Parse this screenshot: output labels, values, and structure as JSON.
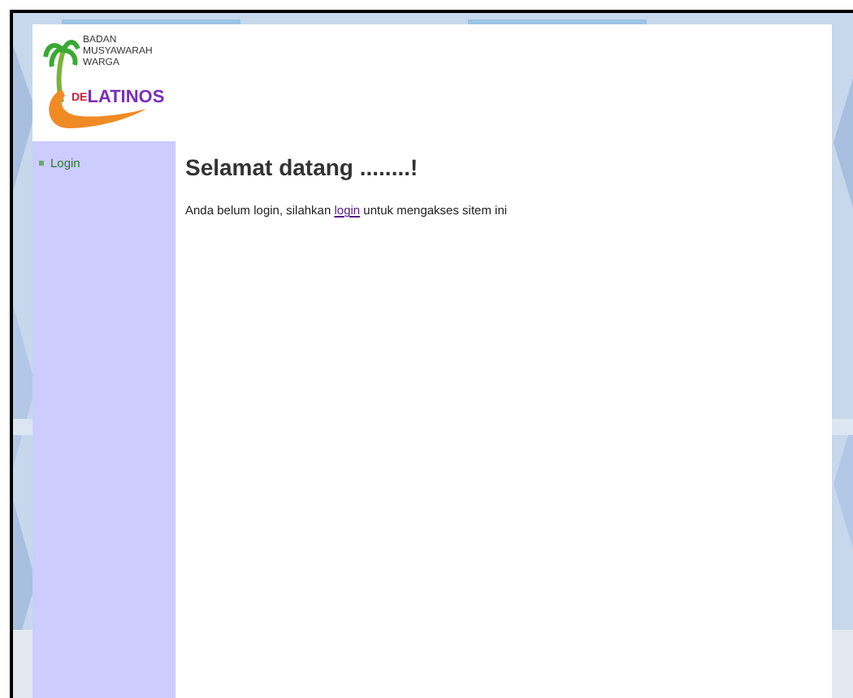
{
  "logo": {
    "lines": [
      "BADAN",
      "MUSYAWARAH",
      "WARGA"
    ],
    "brand_prefix": "DE",
    "brand": "LATINOS"
  },
  "sidebar": {
    "items": [
      {
        "label": "Login"
      }
    ]
  },
  "content": {
    "heading": "Selamat datang ........!",
    "message_before": "Anda belum login, silahkan",
    "link": "login",
    "message_after": "untuk mengakses sitem ini"
  }
}
